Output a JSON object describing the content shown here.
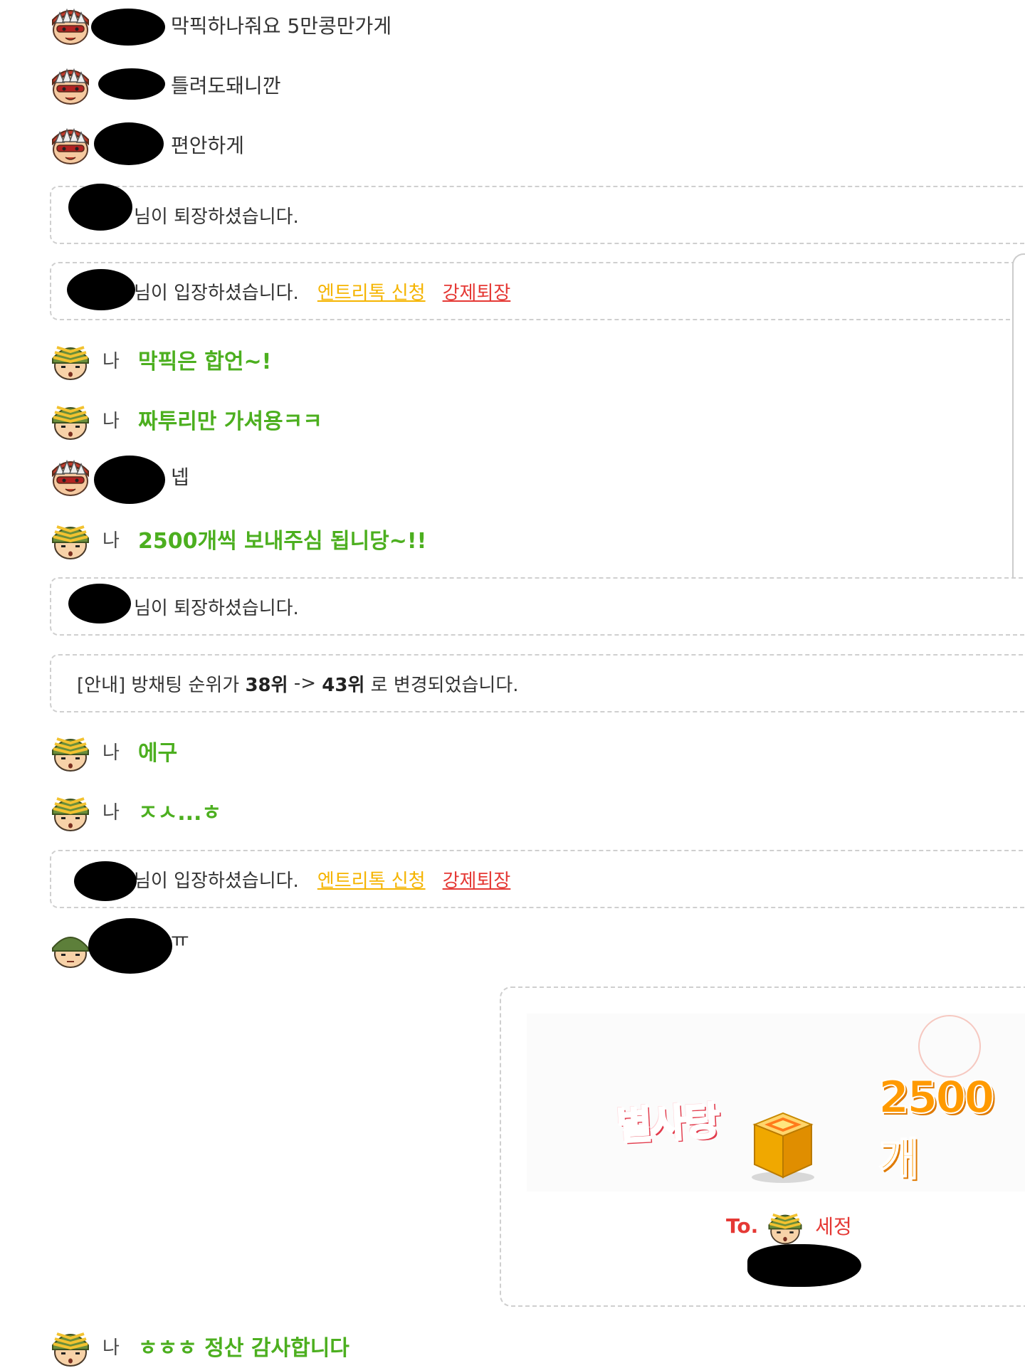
{
  "messages": [
    {
      "text": "막픽하나줘요 5만콩만가게"
    },
    {
      "text": "틀려도돼니깐"
    },
    {
      "text": "편안하게"
    },
    {
      "system": "님이 퇴장하셨습니다."
    },
    {
      "system": "님이 입장하셨습니다.",
      "link1": "엔트리톡 신청",
      "link2": "강제퇴장"
    },
    {
      "nick": "나",
      "text": "막픽은 합언~!"
    },
    {
      "nick": "나",
      "text": "짜투리만 가셔용ㅋㅋ"
    },
    {
      "text": "넵"
    },
    {
      "nick": "나",
      "text": "2500개씩 보내주심 됩니당~!!"
    },
    {
      "system": "님이 퇴장하셨습니다."
    },
    {
      "notice_prefix": "[안내] 방채팅 순위가 ",
      "rank_from": "38위",
      "arrow": " -> ",
      "rank_to": "43위",
      "notice_suffix": " 로 변경되었습니다."
    },
    {
      "nick": "나",
      "text": "에구"
    },
    {
      "nick": "나",
      "text": "ㅈㅅ...ㅎ"
    },
    {
      "system": "님이 입장하셨습니다.",
      "link1": "엔트리톡 신청",
      "link2": "강제퇴장"
    },
    {
      "text": "ㅠ"
    },
    {
      "nick": "나",
      "text": "ㅎㅎㅎ 정산 감사합니다"
    }
  ],
  "gift": {
    "title": "별사탕",
    "count": "2500개",
    "to_label": "To.",
    "to_name": "세정"
  },
  "colors": {
    "me_text": "#4caf1f",
    "link_yellow": "#f5b400",
    "link_red": "#e53935"
  },
  "icons": [
    "avatar-bandit-icon",
    "avatar-soldier-icon",
    "gift-box-icon"
  ]
}
